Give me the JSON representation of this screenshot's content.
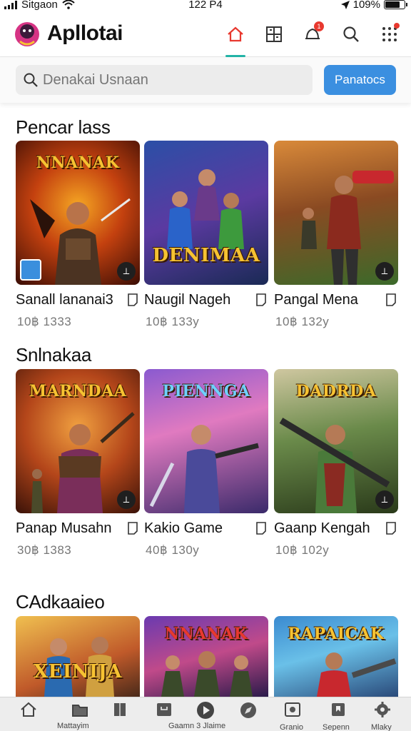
{
  "status_bar": {
    "carrier": "Sitgaon",
    "time": "122 P4",
    "battery": "109%"
  },
  "header": {
    "app_title": "Apllotai",
    "icons": [
      "home-icon",
      "grid-icon",
      "notification-icon",
      "search-icon",
      "apps-menu-icon"
    ],
    "notification_count": "1",
    "accent_color": "#23b4a7"
  },
  "search": {
    "placeholder": "Denakai Usnaan",
    "button_label": "Panatocs",
    "button_color": "#3b8fe0"
  },
  "sections": [
    {
      "title": "Pencar lass",
      "games": [
        {
          "name": "Sanall lananai3",
          "meta": "10฿ 1333",
          "banner": "NNANAK"
        },
        {
          "name": "Naugil Nageh",
          "meta": "10฿ 133y",
          "banner": "DENIMAA"
        },
        {
          "name": "Pangal Mena",
          "meta": "10฿ 132y",
          "banner": ""
        }
      ]
    },
    {
      "title": "Snlnakaa",
      "games": [
        {
          "name": "Panap Musahn",
          "meta": "30฿ 1383",
          "banner": "MARNDAA"
        },
        {
          "name": "Kakio Game",
          "meta": "40฿ 130y",
          "banner": "PIENNGA"
        },
        {
          "name": "Gaanp Kengah",
          "meta": "10฿ 102y",
          "banner": "DADRDA"
        }
      ]
    },
    {
      "title": "CAdkaaieo",
      "games": [
        {
          "name": "",
          "meta": "",
          "banner": "XEINIJA"
        },
        {
          "name": "",
          "meta": "",
          "banner": "NNANAK"
        },
        {
          "name": "",
          "meta": "",
          "banner": "RAPAICAK"
        }
      ]
    }
  ],
  "bottom_nav": {
    "labels": {
      "left": "Mattayim",
      "center": "Gaamn 3 Jlaime",
      "right1": "Granio",
      "right2": "Sepenn",
      "right3": "Mlaky"
    }
  }
}
